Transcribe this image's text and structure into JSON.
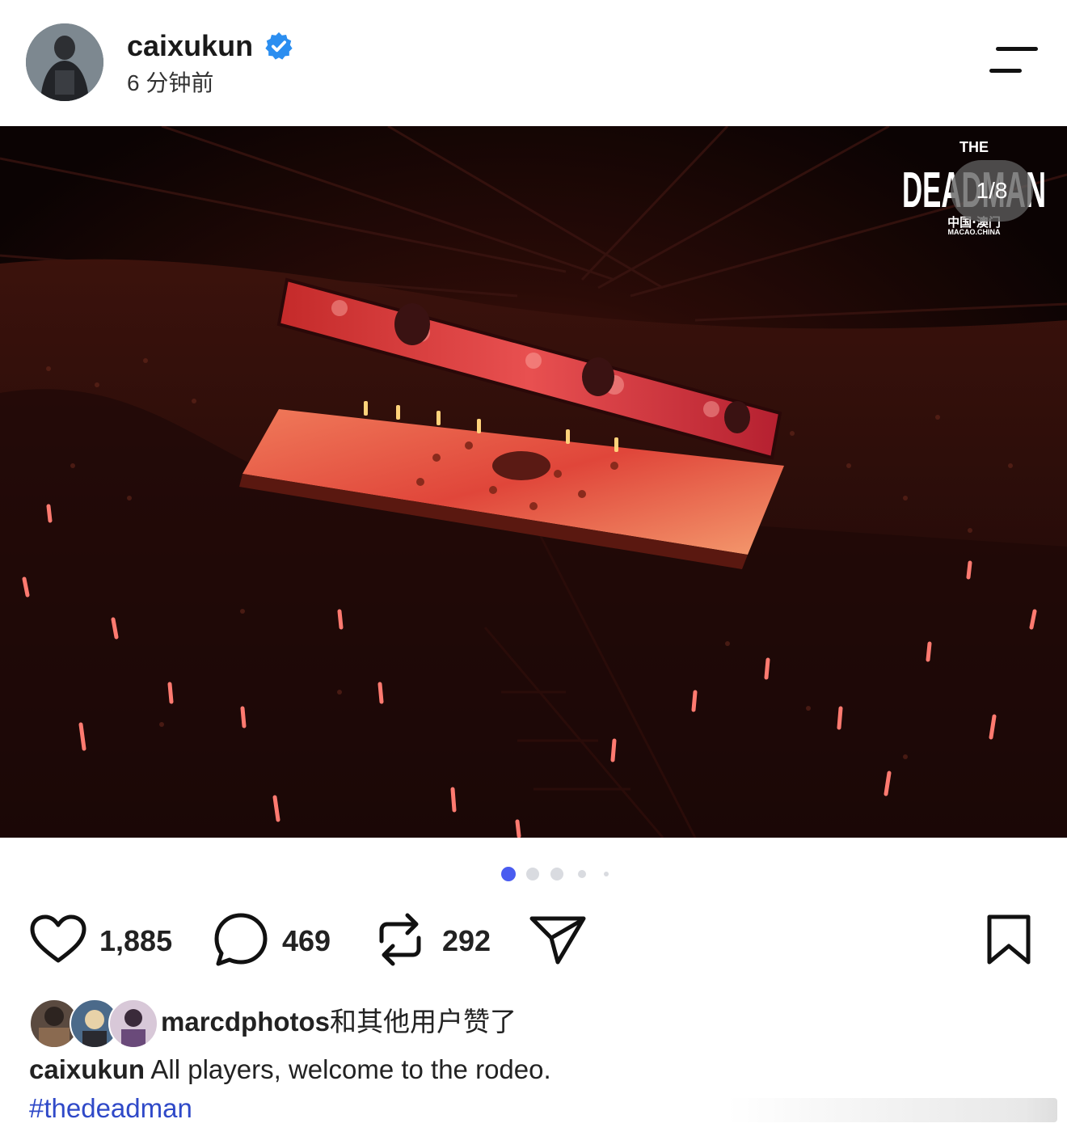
{
  "post": {
    "username": "caixukun",
    "verified": true,
    "timestamp": "6 分钟前",
    "image_counter": "1/8",
    "overlay_logo": {
      "line1": "THE",
      "line2": "DEADMAN",
      "line3": "中国·澳门",
      "line4": "MACAO.CHINA"
    }
  },
  "pagination": {
    "count": 5,
    "active_index": 0,
    "active_color": "#4a5cf0"
  },
  "actions": {
    "likes": "1,885",
    "comments": "469",
    "reposts": "292"
  },
  "liked_by": {
    "user": "marcdphotos",
    "suffix": "和其他用户赞了"
  },
  "caption": {
    "author": "caixukun",
    "text": " All players, welcome to the rodeo.",
    "hashtag": "#thedeadman"
  },
  "colors": {
    "verified_blue": "#2b8ef0",
    "hashtag_blue": "#2f49c8",
    "stage_red": "#e0463a"
  }
}
